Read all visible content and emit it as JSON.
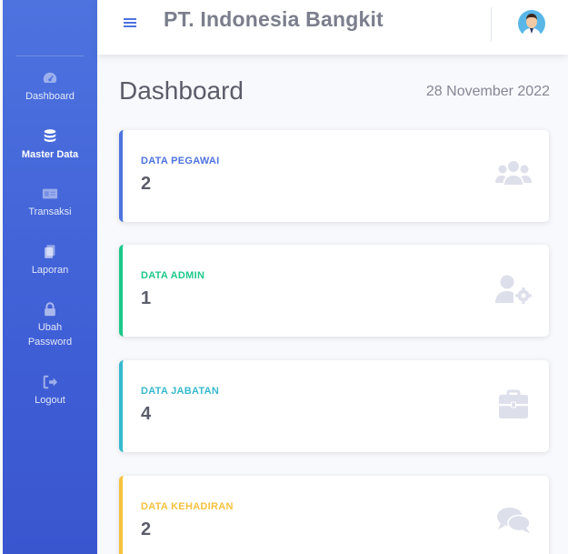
{
  "app": {
    "title": "PT. Indonesia Bangkit"
  },
  "sidebar": {
    "items": [
      {
        "label": "Dashboard",
        "icon": "tachometer-icon",
        "active": false
      },
      {
        "label": "Master Data",
        "icon": "database-icon",
        "active": true
      },
      {
        "label": "Transaksi",
        "icon": "id-card-icon",
        "active": false
      },
      {
        "label": "Laporan",
        "icon": "copy-icon",
        "active": false
      },
      {
        "label": "Ubah Password",
        "icon": "lock-icon",
        "active": false
      },
      {
        "label": "Logout",
        "icon": "sign-out-icon",
        "active": false
      }
    ]
  },
  "header": {
    "menu_icon": "hamburger-icon",
    "avatar_icon": "user-avatar-icon"
  },
  "main": {
    "title": "Dashboard",
    "date": "28 November 2022",
    "cards": [
      {
        "title": "DATA PEGAWAI",
        "value": "2",
        "icon": "users-icon",
        "color": "#4e73df"
      },
      {
        "title": "DATA ADMIN",
        "value": "1",
        "icon": "user-cog-icon",
        "color": "#1cc88a"
      },
      {
        "title": "DATA JABATAN",
        "value": "4",
        "icon": "briefcase-icon",
        "color": "#36b9cc"
      },
      {
        "title": "DATA KEHADIRAN",
        "value": "2",
        "icon": "comments-icon",
        "color": "#f6c23e"
      }
    ]
  },
  "colors": {
    "sidebar": "#4e73df",
    "icon_muted": "#dddfeb",
    "text": "#5a5c69"
  }
}
